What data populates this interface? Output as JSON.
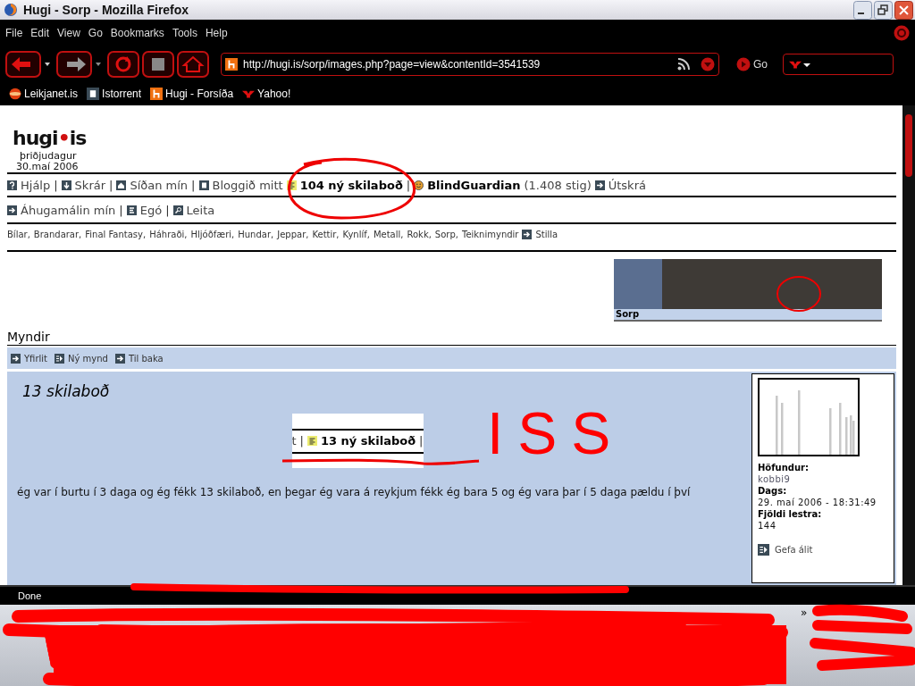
{
  "window": {
    "title": "Hugi - Sorp - Mozilla Firefox"
  },
  "menu": [
    "File",
    "Edit",
    "View",
    "Go",
    "Bookmarks",
    "Tools",
    "Help"
  ],
  "toolbar": {
    "url": "http://hugi.is/sorp/images.php?page=view&contentId=3541539",
    "go": "Go"
  },
  "bookmarks": [
    {
      "kind": "globe",
      "label": "Leikjanet.is"
    },
    {
      "kind": "tile",
      "label": "Istorrent"
    },
    {
      "kind": "h",
      "label": "Hugi - Forsíða"
    },
    {
      "kind": "yahoo",
      "label": "Yahoo!"
    }
  ],
  "page": {
    "logo": {
      "left": "hugi",
      "dot": "•",
      "right": "is"
    },
    "day": "þriðjudagur",
    "date": "30.maí 2006",
    "nav_rows": [
      [
        {
          "kind": "help",
          "text": "Hjálp"
        },
        {
          "kind": "sep",
          "text": "|"
        },
        {
          "kind": "down",
          "text": "Skrár"
        },
        {
          "kind": "sep",
          "text": "|"
        },
        {
          "kind": "home",
          "text": "Síðan mín"
        },
        {
          "kind": "sep",
          "text": "|"
        },
        {
          "kind": "tile",
          "text": "Bloggið mitt"
        },
        {
          "kind": "note",
          "text": "104 ný skilaboð"
        },
        {
          "kind": "sep",
          "text": "|"
        },
        {
          "kind": "smiley",
          "text": "BlindGuardian"
        },
        {
          "kind": "text",
          "text": "(1.408 stig)"
        },
        {
          "kind": "arrow",
          "text": "Útskrá"
        }
      ],
      [
        {
          "kind": "arrow",
          "text": "Áhugamálin mín"
        },
        {
          "kind": "sep",
          "text": "|"
        },
        {
          "kind": "lines",
          "text": "Egó"
        },
        {
          "kind": "sep",
          "text": "|"
        },
        {
          "kind": "search",
          "text": "Leita"
        }
      ]
    ],
    "categories": [
      "Bílar,",
      "Brandarar,",
      "Final Fantasy,",
      "Háhraði,",
      "Hljóðfæri,",
      "Hundar,",
      "Jeppar,",
      "Kettir,",
      "Kynlíf,",
      "Metall,",
      "Rokk,",
      "Sorp,",
      "Teiknimyndir"
    ],
    "settings_link": {
      "text": "Stilla"
    },
    "banner": {
      "caption": "Sorp"
    },
    "section_title": "Myndir",
    "subnav": [
      {
        "kind": "arrow",
        "text": "Yfirlit"
      },
      {
        "kind": "newimage",
        "text": "Ný mynd"
      },
      {
        "kind": "arrow",
        "text": "Til baka"
      }
    ],
    "post": {
      "title": "13 skilaboð",
      "snippet": [
        {
          "kind": "text",
          "text": "t"
        },
        {
          "kind": "sep",
          "text": "|"
        },
        {
          "kind": "note",
          "text": "13 ný skilaboð"
        },
        {
          "kind": "sep",
          "text": "|"
        }
      ],
      "body": "ég var í burtu í 3 daga og ég fékk 13 skilaboð, en þegar ég vara á reykjum fékk ég bara 5 og ég vara þar í 5 daga pældu í því",
      "author_label": "Höfundur:",
      "author": "kobbi9",
      "date_label": "Dags:",
      "date": "29. maí 2006 - 18:31:49",
      "reads_label": "Fjöldi lestra:",
      "reads": "144",
      "feedback": "Gefa álit"
    }
  },
  "annotation": {
    "text": "ISS"
  },
  "status_bar": {
    "text": "Done"
  },
  "taskbar": {
    "chevron": "»"
  }
}
